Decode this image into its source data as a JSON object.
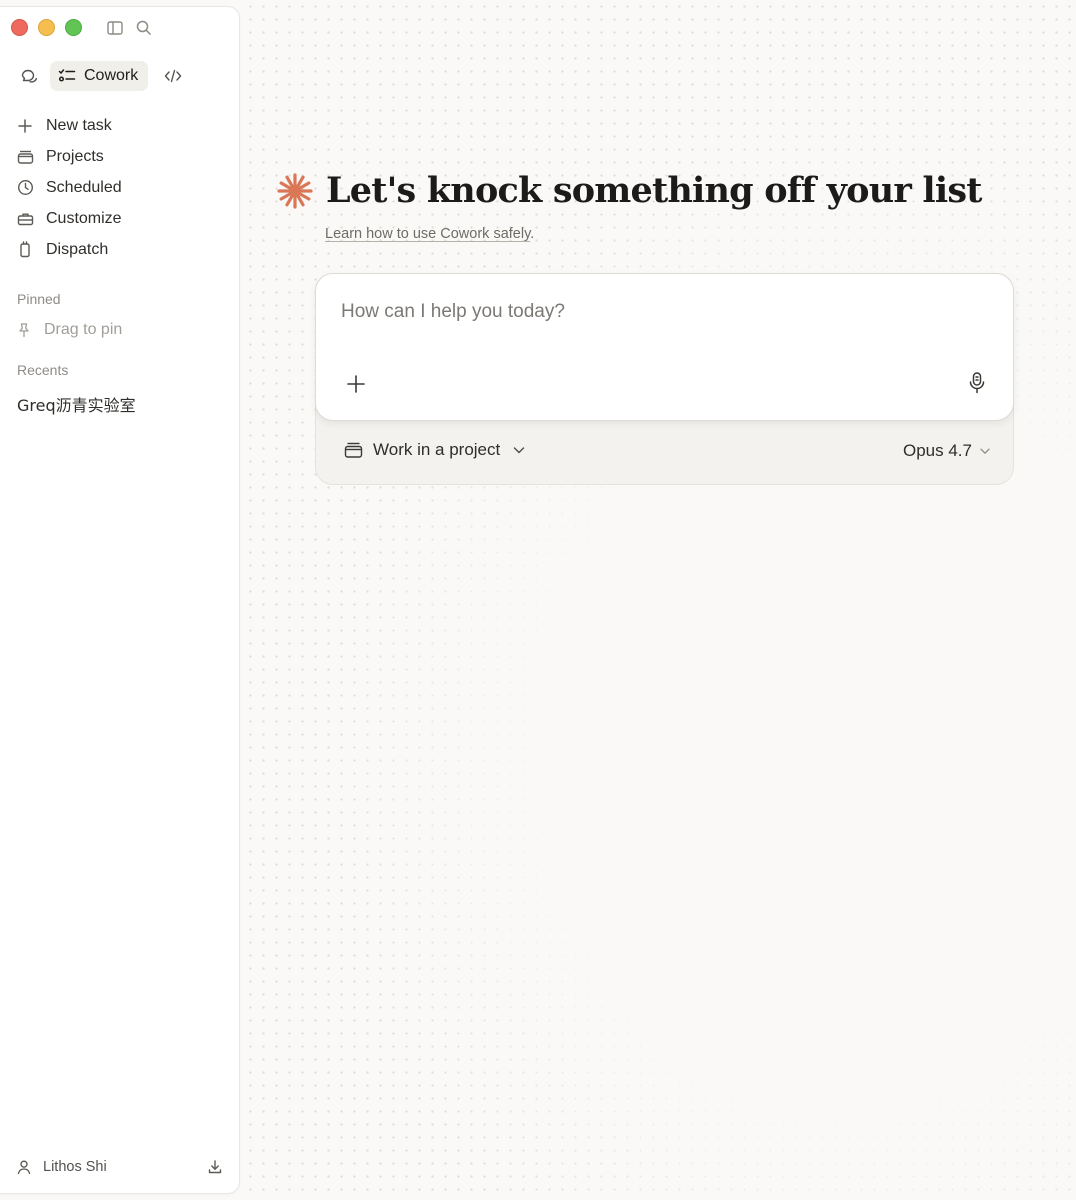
{
  "colors": {
    "accent_star": "#d97757",
    "background": "#faf9f7",
    "sidebar_bg": "#ffffff",
    "active_pill": "#f1efea"
  },
  "titlebar": {
    "icons": [
      "sidebar-toggle-icon",
      "search-icon"
    ]
  },
  "modes": {
    "items": [
      {
        "name": "chat",
        "icon": "chat-bubbles-icon",
        "label": ""
      },
      {
        "name": "cowork",
        "icon": "checklist-icon",
        "label": "Cowork",
        "active": true
      },
      {
        "name": "code",
        "icon": "code-brackets-icon",
        "label": ""
      }
    ]
  },
  "sidebar": {
    "nav": [
      {
        "icon": "plus-icon",
        "label": "New task"
      },
      {
        "icon": "folder-icon",
        "label": "Projects"
      },
      {
        "icon": "clock-icon",
        "label": "Scheduled"
      },
      {
        "icon": "toolbox-icon",
        "label": "Customize"
      },
      {
        "icon": "phone-icon",
        "label": "Dispatch"
      }
    ],
    "pinned_label": "Pinned",
    "pin_placeholder": "Drag to pin",
    "recents_label": "Recents",
    "recents": [
      "Greq沥青实验室"
    ],
    "user": {
      "name": "Lithos Shi",
      "icon": "user-icon",
      "action_icon": "download-icon"
    }
  },
  "main": {
    "title": "Let's knock something off your list",
    "subtitle_link": "Learn how to use Cowork safely",
    "subtitle_suffix": ".",
    "composer": {
      "placeholder": "How can I help you today?",
      "value": ""
    },
    "project_selector": "Work in a project",
    "model_selector": "Opus 4.7"
  }
}
